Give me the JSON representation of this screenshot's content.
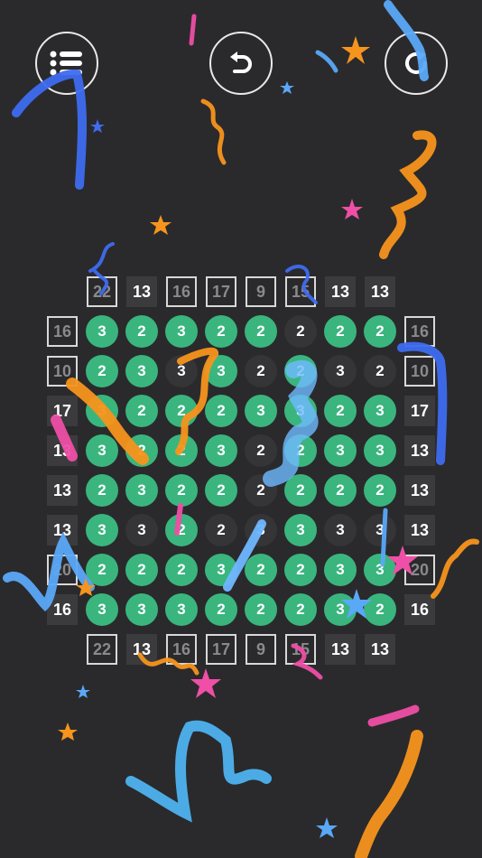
{
  "toolbar": {
    "menu_icon": "list-icon",
    "undo_icon": "undo-icon",
    "restart_icon": "restart-icon"
  },
  "colors": {
    "background": "#2a2a2c",
    "cell_on": "#3ab57e",
    "cell_off": "#353538",
    "clue_filled": "#3b3b3e",
    "clue_outline": "#d8d8d8"
  },
  "board": {
    "col_clues_top": [
      {
        "value": "22",
        "boxed": true
      },
      {
        "value": "13",
        "boxed": false
      },
      {
        "value": "16",
        "boxed": true
      },
      {
        "value": "17",
        "boxed": true
      },
      {
        "value": "9",
        "boxed": true
      },
      {
        "value": "15",
        "boxed": true
      },
      {
        "value": "13",
        "boxed": false
      },
      {
        "value": "13",
        "boxed": false
      }
    ],
    "col_clues_bottom": [
      {
        "value": "22",
        "boxed": true
      },
      {
        "value": "13",
        "boxed": false
      },
      {
        "value": "16",
        "boxed": true
      },
      {
        "value": "17",
        "boxed": true
      },
      {
        "value": "9",
        "boxed": true
      },
      {
        "value": "15",
        "boxed": true
      },
      {
        "value": "13",
        "boxed": false
      },
      {
        "value": "13",
        "boxed": false
      }
    ],
    "row_clues_left": [
      {
        "value": "16",
        "boxed": true
      },
      {
        "value": "10",
        "boxed": true
      },
      {
        "value": "17",
        "boxed": false
      },
      {
        "value": "13",
        "boxed": false
      },
      {
        "value": "13",
        "boxed": false
      },
      {
        "value": "13",
        "boxed": false
      },
      {
        "value": "20",
        "boxed": true
      },
      {
        "value": "16",
        "boxed": false
      }
    ],
    "row_clues_right": [
      {
        "value": "16",
        "boxed": true
      },
      {
        "value": "10",
        "boxed": true
      },
      {
        "value": "17",
        "boxed": false
      },
      {
        "value": "13",
        "boxed": false
      },
      {
        "value": "13",
        "boxed": false
      },
      {
        "value": "13",
        "boxed": false
      },
      {
        "value": "20",
        "boxed": true
      },
      {
        "value": "16",
        "boxed": false
      }
    ],
    "cells": [
      [
        {
          "v": "3",
          "on": true
        },
        {
          "v": "2",
          "on": true
        },
        {
          "v": "3",
          "on": true
        },
        {
          "v": "2",
          "on": true
        },
        {
          "v": "2",
          "on": true
        },
        {
          "v": "2",
          "on": false
        },
        {
          "v": "2",
          "on": true
        },
        {
          "v": "2",
          "on": true
        }
      ],
      [
        {
          "v": "2",
          "on": true
        },
        {
          "v": "3",
          "on": true
        },
        {
          "v": "3",
          "on": false
        },
        {
          "v": "3",
          "on": true
        },
        {
          "v": "2",
          "on": false
        },
        {
          "v": "2",
          "on": true
        },
        {
          "v": "3",
          "on": false
        },
        {
          "v": "2",
          "on": false
        }
      ],
      [
        {
          "v": "3",
          "on": true
        },
        {
          "v": "2",
          "on": true
        },
        {
          "v": "2",
          "on": true
        },
        {
          "v": "2",
          "on": true
        },
        {
          "v": "3",
          "on": true
        },
        {
          "v": "3",
          "on": true
        },
        {
          "v": "2",
          "on": true
        },
        {
          "v": "3",
          "on": true
        }
      ],
      [
        {
          "v": "3",
          "on": true
        },
        {
          "v": "2",
          "on": true
        },
        {
          "v": "2",
          "on": true
        },
        {
          "v": "3",
          "on": true
        },
        {
          "v": "2",
          "on": false
        },
        {
          "v": "2",
          "on": true
        },
        {
          "v": "3",
          "on": true
        },
        {
          "v": "3",
          "on": true
        }
      ],
      [
        {
          "v": "2",
          "on": true
        },
        {
          "v": "3",
          "on": true
        },
        {
          "v": "2",
          "on": true
        },
        {
          "v": "2",
          "on": true
        },
        {
          "v": "2",
          "on": false
        },
        {
          "v": "2",
          "on": true
        },
        {
          "v": "2",
          "on": true
        },
        {
          "v": "2",
          "on": true
        }
      ],
      [
        {
          "v": "3",
          "on": true
        },
        {
          "v": "3",
          "on": false
        },
        {
          "v": "2",
          "on": true
        },
        {
          "v": "2",
          "on": false
        },
        {
          "v": "3",
          "on": false
        },
        {
          "v": "3",
          "on": true
        },
        {
          "v": "3",
          "on": false
        },
        {
          "v": "3",
          "on": false
        }
      ],
      [
        {
          "v": "2",
          "on": true
        },
        {
          "v": "2",
          "on": true
        },
        {
          "v": "2",
          "on": true
        },
        {
          "v": "3",
          "on": true
        },
        {
          "v": "2",
          "on": true
        },
        {
          "v": "2",
          "on": true
        },
        {
          "v": "3",
          "on": true
        },
        {
          "v": "3",
          "on": true
        }
      ],
      [
        {
          "v": "3",
          "on": true
        },
        {
          "v": "3",
          "on": true
        },
        {
          "v": "3",
          "on": true
        },
        {
          "v": "2",
          "on": true
        },
        {
          "v": "2",
          "on": true
        },
        {
          "v": "2",
          "on": true
        },
        {
          "v": "3",
          "on": true
        },
        {
          "v": "2",
          "on": true
        }
      ]
    ]
  }
}
